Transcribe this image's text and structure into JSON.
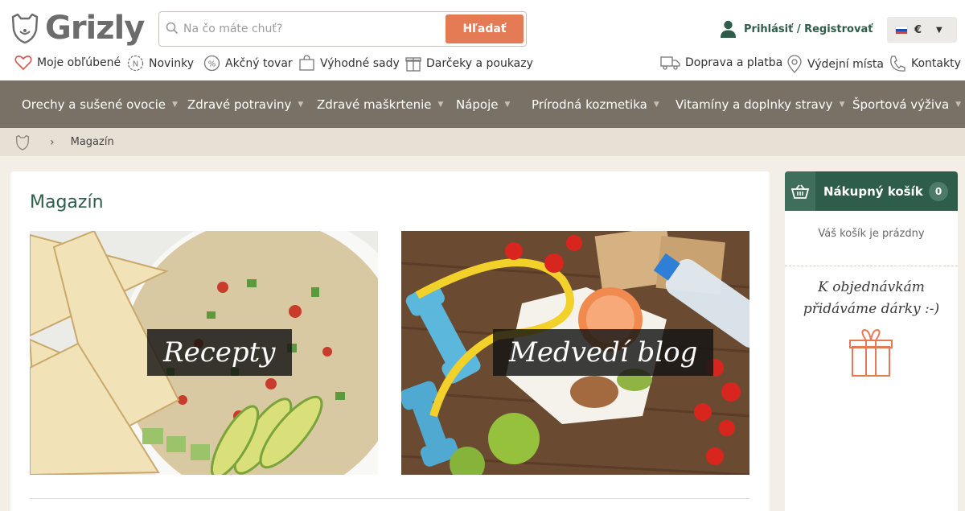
{
  "header": {
    "brand": "Grizly",
    "search": {
      "placeholder": "Na čo máte chuť?",
      "button": "Hľadať"
    },
    "login": "Prihlásiť / Registrovať",
    "currency": "€"
  },
  "subnav": {
    "left": [
      {
        "label": "Moje obľúbené",
        "icon": "heart-icon"
      },
      {
        "label": "Novinky",
        "icon": "new-badge-icon"
      },
      {
        "label": "Akčný tovar",
        "icon": "percent-icon"
      },
      {
        "label": "Výhodné sady",
        "icon": "bag-icon"
      },
      {
        "label": "Darčeky a poukazy",
        "icon": "gift-icon"
      }
    ],
    "right": [
      {
        "label": "Doprava a platba",
        "icon": "truck-icon"
      },
      {
        "label": "Výdejní místa",
        "icon": "map-pin-icon"
      },
      {
        "label": "Kontakty",
        "icon": "phone-icon"
      }
    ]
  },
  "mainnav": [
    "Orechy a sušené ovocie",
    "Zdravé potraviny",
    "Zdravé maškrtenie",
    "Nápoje",
    "Prírodná kozmetika",
    "Vitamíny a doplnky stravy",
    "Športová výživa"
  ],
  "breadcrumb": {
    "current": "Magazín"
  },
  "main": {
    "title": "Magazín",
    "cards": [
      {
        "label": "Recepty"
      },
      {
        "label": "Medvedí blog"
      }
    ]
  },
  "cart": {
    "title": "Nákupný košík",
    "count": "0",
    "empty": "Váš košík je prázdny",
    "gift_line1": "K objednávkám",
    "gift_line2": "přidáváme dárky :-)"
  },
  "colors": {
    "brand_green": "#2f5d4c",
    "accent_orange": "#e57b55",
    "nav_brown": "#7a7166"
  }
}
